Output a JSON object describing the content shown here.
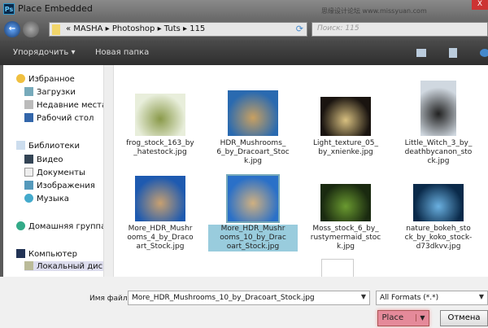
{
  "window": {
    "title": "Place Embedded",
    "watermark": "思缘设计论坛 www.missyuan.com",
    "close": "X"
  },
  "nav": {
    "breadcrumbs": "« MASHA ▸ Photoshop ▸ Tuts ▸ 115",
    "search_placeholder": "Поиск: 115"
  },
  "toolbar": {
    "organize": "Упорядочить ▾",
    "new_folder": "Новая папка"
  },
  "sidebar": {
    "favorites": "Избранное",
    "downloads": "Загрузки",
    "recent": "Недавние места",
    "desktop": "Рабочий стол",
    "libraries": "Библиотеки",
    "video": "Видео",
    "documents": "Документы",
    "images": "Изображения",
    "music": "Музыка",
    "homegroup": "Домашняя группа",
    "computer": "Компьютер",
    "local_disk": "Локальный диск"
  },
  "files": [
    {
      "name": "frog_stock_163_by _hatestock.jpg",
      "colors": [
        "#e8eedb",
        "#8a9a4a"
      ]
    },
    {
      "name": "HDR_Mushrooms_ 6_by_Dracoart_Stoc k.jpg",
      "colors": [
        "#2a6ab0",
        "#c9a060"
      ]
    },
    {
      "name": "Light_texture_05_ by_xnienke.jpg",
      "colors": [
        "#1a1410",
        "#d8c080"
      ]
    },
    {
      "name": "Little_Witch_3_by_ deathbycanon_sto ck.jpg",
      "colors": [
        "#d0d8e0",
        "#222"
      ]
    },
    {
      "name": "More_HDR_Mushr ooms_4_by_Draco art_Stock.jpg",
      "colors": [
        "#1e5ab0",
        "#c8a070"
      ]
    },
    {
      "name": "More_HDR_Mushr ooms_10_by_Drac oart_Stock.jpg",
      "colors": [
        "#2a70c8",
        "#d0b080"
      ]
    },
    {
      "name": "Moss_stock_6_by_ rustymermaid_stoc k.jpg",
      "colors": [
        "#1a2a10",
        "#6a9a30"
      ]
    },
    {
      "name": "nature_bokeh_sto ck_by_koko_stock- d73dkvv.jpg",
      "colors": [
        "#0a2a4a",
        "#6ab0e0"
      ]
    }
  ],
  "selected_index": 5,
  "footer": {
    "filename_label": "Имя файла:",
    "filename": "More_HDR_Mushrooms_10_by_Dracoart_Stock.jpg",
    "format": "All Formats (*.*)",
    "place": "Place",
    "cancel": "Отмена"
  }
}
